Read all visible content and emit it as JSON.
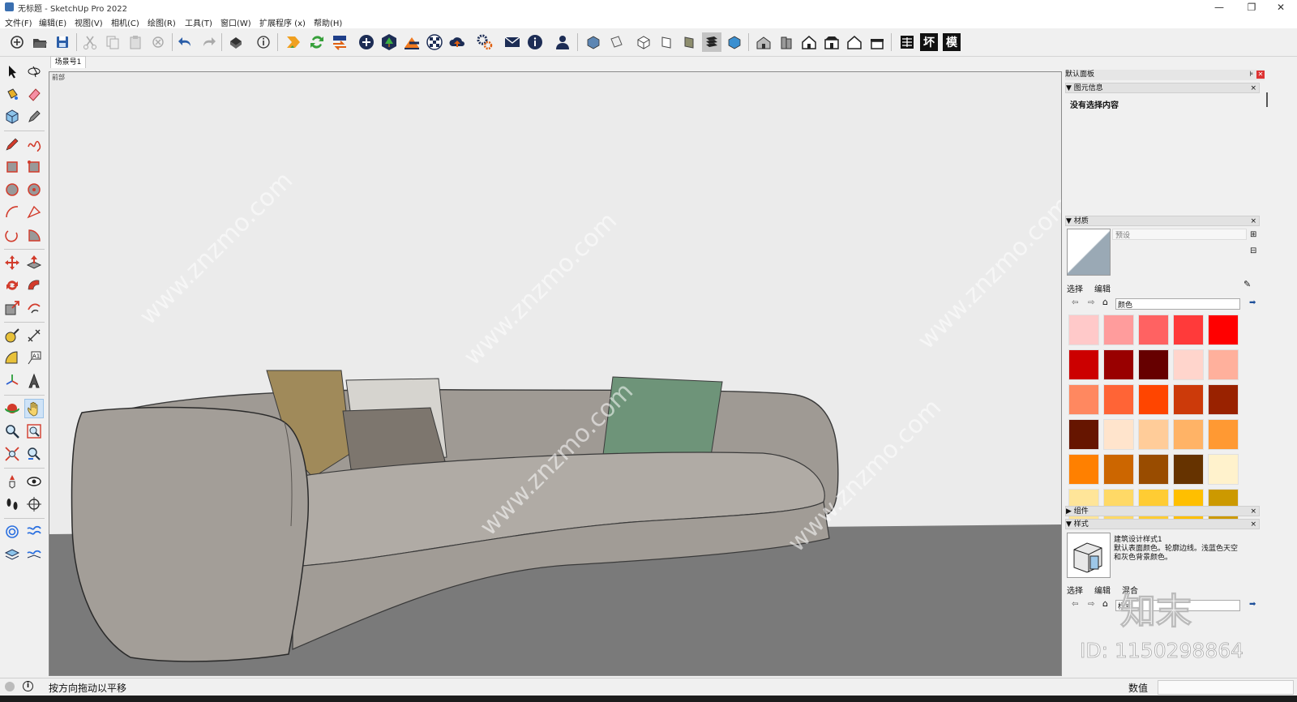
{
  "window": {
    "title": "无标题 - SketchUp Pro 2022",
    "controls": [
      "—",
      "❐",
      "✕"
    ]
  },
  "menu": {
    "items": [
      "文件(F)",
      "编辑(E)",
      "视图(V)",
      "相机(C)",
      "绘图(R)",
      "工具(T)",
      "窗口(W)",
      "扩展程序 (x)",
      "帮助(H)"
    ]
  },
  "toolbar": {
    "text_buttons": [
      "坏",
      "模"
    ],
    "icons": [
      "new-icon",
      "open-icon",
      "save-icon",
      "cut-icon",
      "copy-icon",
      "paste-icon",
      "erase-icon",
      "undo-icon",
      "redo-icon",
      "print-icon",
      "model-info-icon",
      "extension-warehouse-icon",
      "refresh-icon",
      "transfer-icon",
      "add-location-icon",
      "tree-icon",
      "sandbox-icon",
      "checker-icon",
      "cloud-upload-icon",
      "settings-gears-icon",
      "mail-icon",
      "info-icon",
      "user-icon",
      "iso-view-icon",
      "top-view-icon",
      "front-view-icon",
      "right-view-icon",
      "back-view-icon",
      "left-view-icon",
      "house-xray-icon",
      "house-wireframe-icon",
      "house-hidden-icon",
      "house-shaded-icon",
      "house-textured-icon",
      "house-mono-icon",
      "table-icon"
    ]
  },
  "scene": {
    "tab_label": "场景号1",
    "viewport_label": "前部"
  },
  "watermark": {
    "site": "www.znzmo.com",
    "brand": "知末网",
    "logo": "知末",
    "id": "ID: 1150298864"
  },
  "panel": {
    "title": "默认面板",
    "entity_info": {
      "header": "图元信息",
      "message": "没有选择内容"
    },
    "materials": {
      "header": "材质",
      "preset_label": "预设",
      "tab_select": "选择",
      "tab_edit": "编辑",
      "dropdown_value": "颜色",
      "swatches": [
        "#ffc9c9",
        "#ff9c9c",
        "#ff6262",
        "#ff3a3a",
        "#ff0000",
        "#cc0000",
        "#990000",
        "#660000",
        "#ffd5cc",
        "#ffb09c",
        "#ff8860",
        "#ff6436",
        "#ff4500",
        "#cc3a0a",
        "#992200",
        "#661500",
        "#ffe4cc",
        "#ffcc99",
        "#ffb366",
        "#ff9933",
        "#ff8000",
        "#cc6600",
        "#994c00",
        "#663300",
        "#fff2cc",
        "#ffe599",
        "#ffd966",
        "#ffcc33",
        "#ffbf00",
        "#cc9900"
      ]
    },
    "components": {
      "header": "组件"
    },
    "styles": {
      "header": "样式",
      "style_name": "建筑设计样式1",
      "style_desc": "默认表面颜色。轮廓边线。浅蓝色天空和灰色背景颜色。",
      "tab_select": "选择",
      "tab_edit": "编辑",
      "tab_mix": "混合",
      "dropdown_value": "样式"
    }
  },
  "status": {
    "hint": "按方向拖动以平移",
    "measure_label": "数值"
  },
  "colors": {
    "sky": "#ebebeb",
    "ground": "#7a7a7a",
    "sofa": "#a29d97",
    "sofa_shadow": "#8e8983",
    "pillow_gold": "#a08a5a",
    "pillow_green": "#6e9479",
    "pillow_grey": "#7d766e"
  }
}
